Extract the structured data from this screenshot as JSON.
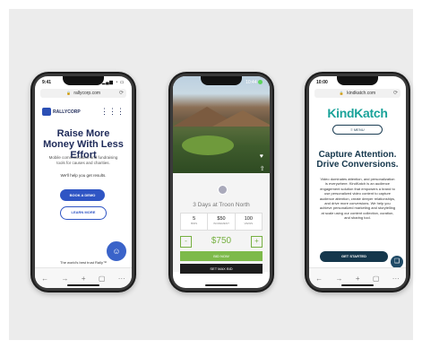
{
  "phone1": {
    "status": {
      "time": "9:41",
      "system": "▂▄▆ ◔ ▭"
    },
    "url": "rallycorp.com",
    "logo": "RALLYCORP",
    "menu_icon": "grid-icon",
    "title": "Raise More Money With Less Effort",
    "subtitle": "Mobile communication and fundraising tools for causes and charities.",
    "help_text": "We'll help you get results.",
    "demo_button": "BOOK A DEMO",
    "learn_button": "LEARN MORE",
    "footer_text": "The world's best trust Rally™",
    "nav": [
      "←",
      "→",
      "+",
      "▢",
      "···"
    ]
  },
  "phone2": {
    "status": {
      "time": "10:44"
    },
    "auction_title": "3 Days at Troon North",
    "stats": [
      {
        "value": "5",
        "label": "BIDS"
      },
      {
        "value": "$50",
        "label": "INCREMENT"
      },
      {
        "value": "100",
        "label": "VIEWS"
      }
    ],
    "price": "$750",
    "minus": "-",
    "plus": "+",
    "bid_button": "BID NOW",
    "max_button": "SET MAX BID",
    "accent": "#76b041"
  },
  "phone3": {
    "status": {
      "time": "10:00"
    },
    "url": "kindkatch.com",
    "logo": "KindKatch",
    "menu_button": "≡ MENU",
    "title": "Capture Attention. Drive Conversions.",
    "body": "Video dominates attention, and personalization is everywhere. KindKatch is an audience engagement solution that empowers a brand to use personalized video content to capture audience attention, create deeper relationships, and drive more conversions. We help you achieve personalized marketing and storytelling at scale using our content collection, curation, and sharing tool.",
    "cta_button": "GET STARTED",
    "accent": "#1aa39a",
    "nav": [
      "←",
      "→",
      "+",
      "▢",
      "···"
    ]
  }
}
